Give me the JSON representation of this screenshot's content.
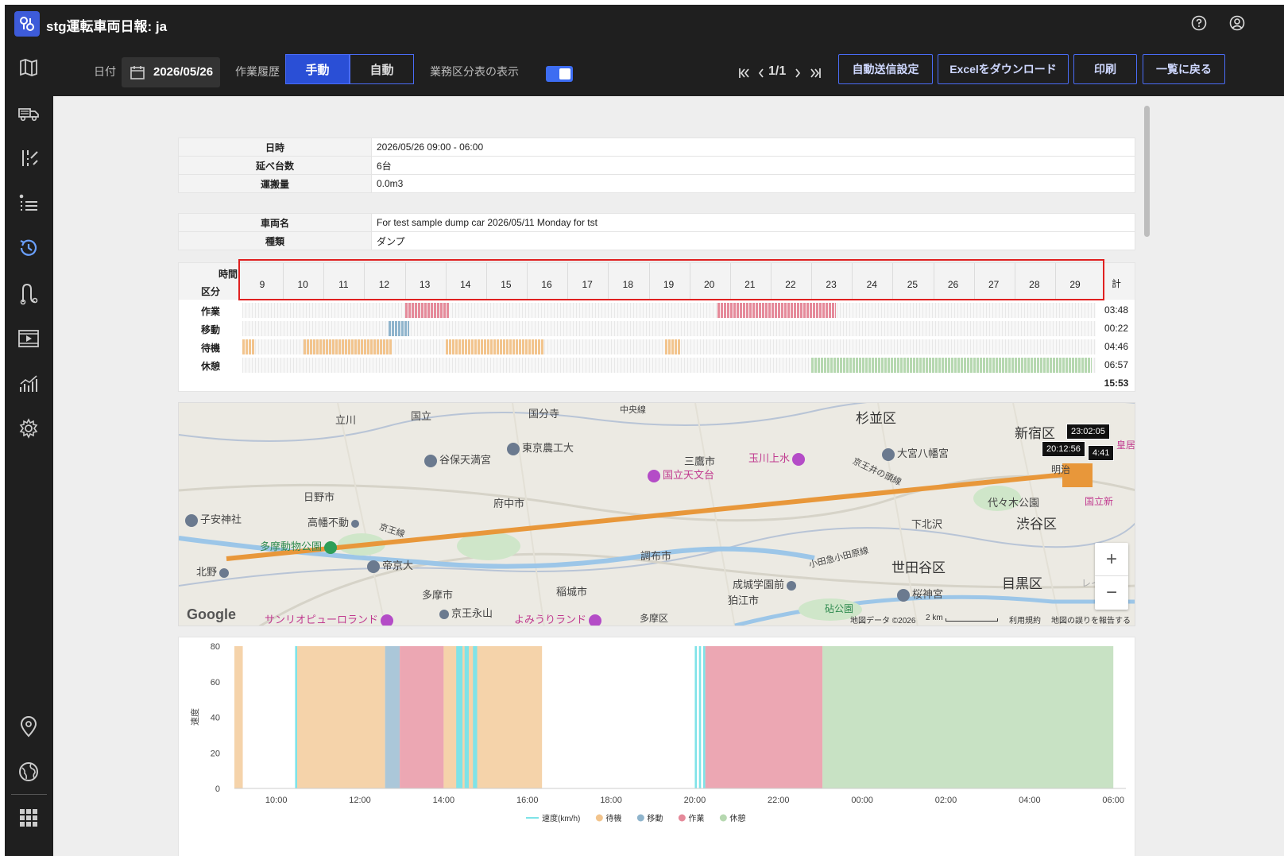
{
  "app": {
    "title": "stg運転車両日報: ja"
  },
  "toolbar": {
    "date_label": "日付",
    "date_value": "2026/05/26",
    "history_label": "作業履歴",
    "mode_manual": "手動",
    "mode_auto": "自動",
    "category_label": "業務区分表の表示",
    "category_toggle_on": true,
    "pager_text": "1/1",
    "auto_send_button": "自動送信設定",
    "excel_button": "Excelをダウンロード",
    "print_button": "印刷",
    "back_button": "一覧に戻る"
  },
  "icons": {
    "sidebar": [
      "map-icon",
      "truck-icon",
      "sort-icon",
      "list-icon",
      "history-icon",
      "route-icon",
      "video-icon",
      "analytics-icon",
      "gear-icon",
      "location-pin-icon",
      "globe-icon",
      "apps-grid-icon"
    ],
    "titlebar": [
      "help-icon",
      "user-account-icon"
    ]
  },
  "summary": [
    {
      "label": "日時",
      "value": "2026/05/26 09:00 - 06:00"
    },
    {
      "label": "延べ台数",
      "value": "6台"
    },
    {
      "label": "運搬量",
      "value": "0.0m3"
    }
  ],
  "vehicle": [
    {
      "label": "車両名",
      "value": "For test sample dump car 2026/05/11 Monday for tst"
    },
    {
      "label": "種類",
      "value": "ダンプ"
    }
  ],
  "timeline": {
    "header_time": "時間",
    "header_category": "区分",
    "total_label": "計",
    "hours": [
      "9",
      "10",
      "11",
      "12",
      "13",
      "14",
      "15",
      "16",
      "17",
      "18",
      "19",
      "20",
      "21",
      "22",
      "23",
      "24",
      "25",
      "26",
      "27",
      "28",
      "29"
    ],
    "hour_start": 9,
    "hour_end": 30,
    "rows": [
      {
        "label": "作業",
        "color": "#e58a9a",
        "total": "03:48",
        "spans": [
          [
            13.0,
            14.1
          ],
          [
            20.7,
            23.6
          ]
        ]
      },
      {
        "label": "移動",
        "color": "#8fb4cc",
        "total": "00:22",
        "spans": [
          [
            12.6,
            13.1
          ]
        ]
      },
      {
        "label": "待機",
        "color": "#f2c48d",
        "total": "04:46",
        "spans": [
          [
            9.0,
            9.3
          ],
          [
            10.5,
            12.7
          ],
          [
            14.0,
            16.4
          ],
          [
            19.4,
            19.8
          ]
        ]
      },
      {
        "label": "休憩",
        "color": "#b6d8b0",
        "total": "06:57",
        "spans": [
          [
            23.0,
            29.9
          ]
        ]
      }
    ],
    "grand_total": "15:53"
  },
  "map": {
    "labels": [
      "杉並区",
      "新宿区",
      "渋谷区",
      "世田谷区",
      "目黒区",
      "三鷹市",
      "調布市",
      "府中市",
      "日野市",
      "多摩市",
      "稲城市",
      "狛江市",
      "国立",
      "立川",
      "国分寺",
      "下北沢",
      "代々木公園",
      "国立天文台",
      "玉川上水",
      "東京農工大",
      "谷保天満宮",
      "大宮八幡宮",
      "高幡不動",
      "多摩動物公園",
      "帝京大",
      "京王永山",
      "成城学園前",
      "桜神宮",
      "子安神社",
      "北野",
      "サンリオピューロランド",
      "よみうりランド",
      "多摩区",
      "砧公園",
      "国立新",
      "明治",
      "京王線",
      "京王井の頭線",
      "小田急小田原線",
      "中央線",
      "レイン",
      "皇居"
    ],
    "tooltips": [
      "23:02:05",
      "20:12:56",
      "4:41"
    ],
    "google": "Google",
    "credit_data": "地図データ ©2026",
    "credit_scale": "2 km",
    "credit_terms": "利用規約",
    "credit_report": "地図の誤りを報告する",
    "zoom_in": "+",
    "zoom_out": "−",
    "route_color": "#e8973a"
  },
  "chart_data": {
    "type": "area",
    "ylabel": "速度",
    "ylim": [
      0,
      80
    ],
    "y_ticks": [
      0,
      20,
      40,
      60,
      80
    ],
    "x_ticks": [
      "10:00",
      "12:00",
      "14:00",
      "16:00",
      "18:00",
      "20:00",
      "22:00",
      "00:00",
      "02:00",
      "04:00",
      "06:00"
    ],
    "x_range_hours": [
      9.0,
      30.3
    ],
    "bands": [
      {
        "category": "待機",
        "start": 9.0,
        "end": 9.2
      },
      {
        "category": "待機",
        "start": 10.5,
        "end": 12.6
      },
      {
        "category": "移動",
        "start": 12.6,
        "end": 12.95
      },
      {
        "category": "作業",
        "start": 12.95,
        "end": 14.0
      },
      {
        "category": "待機",
        "start": 14.0,
        "end": 16.35
      },
      {
        "category": "作業",
        "start": 20.25,
        "end": 23.05
      },
      {
        "category": "休憩",
        "start": 23.05,
        "end": 30.0
      }
    ],
    "speed_spikes": [
      [
        10.45,
        10.5
      ],
      [
        14.3,
        14.45
      ],
      [
        14.5,
        14.6
      ],
      [
        14.7,
        14.8
      ],
      [
        20.0,
        20.05
      ],
      [
        20.1,
        20.15
      ],
      [
        20.2,
        20.25
      ]
    ],
    "legend": [
      {
        "name": "速度(km/h)",
        "color": "#7fe3e8"
      },
      {
        "name": "待機",
        "color": "#f2c48d"
      },
      {
        "name": "移動",
        "color": "#8fb4cc"
      },
      {
        "name": "作業",
        "color": "#e58a9a"
      },
      {
        "name": "休憩",
        "color": "#b6d8b0"
      }
    ]
  }
}
